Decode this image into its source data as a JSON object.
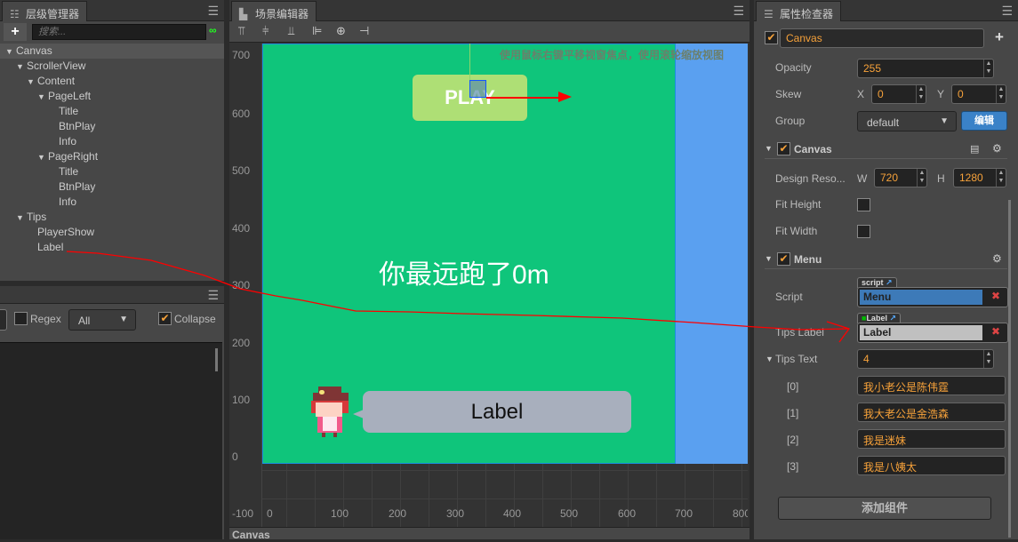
{
  "hierarchy": {
    "title": "层级管理器",
    "search_placeholder": "搜索...",
    "add": "+",
    "items": [
      {
        "label": "Canvas",
        "depth": 0,
        "expanded": true
      },
      {
        "label": "ScrollerView",
        "depth": 1,
        "expanded": true
      },
      {
        "label": "Content",
        "depth": 2,
        "expanded": true
      },
      {
        "label": "PageLeft",
        "depth": 3,
        "expanded": true
      },
      {
        "label": "Title",
        "depth": 4
      },
      {
        "label": "BtnPlay",
        "depth": 4
      },
      {
        "label": "Info",
        "depth": 4
      },
      {
        "label": "PageRight",
        "depth": 3,
        "expanded": true
      },
      {
        "label": "Title",
        "depth": 4
      },
      {
        "label": "BtnPlay",
        "depth": 4
      },
      {
        "label": "Info",
        "depth": 4
      },
      {
        "label": "Tips",
        "depth": 1,
        "expanded": true
      },
      {
        "label": "PlayerShow",
        "depth": 2
      },
      {
        "label": "Label",
        "depth": 2
      }
    ]
  },
  "console": {
    "regex": "Regex",
    "filter": "All",
    "collapse": "Collapse",
    "collapse_checked": true,
    "regex_checked": false
  },
  "scene": {
    "title": "场景编辑器",
    "hint": "使用鼠标右键平移视窗焦点，使用滚轮缩放视图",
    "play_label": "PLAY",
    "distance_text": "你最远跑了0m",
    "bubble_label": "Label",
    "status": "Canvas",
    "y_ticks": [
      "700",
      "600",
      "500",
      "400",
      "300",
      "200",
      "100",
      "0",
      "-100"
    ],
    "x_ticks": [
      "0",
      "100",
      "200",
      "300",
      "400",
      "500",
      "600",
      "700",
      "800"
    ],
    "colors": {
      "canvas": "#0fc57b",
      "outside": "#5aa0f0",
      "play_button": "#aedf75",
      "bubble": "#a8afbd"
    }
  },
  "inspector": {
    "title": "属性检查器",
    "node_name": "Canvas",
    "node_enabled": true,
    "opacity_label": "Opacity",
    "opacity": "255",
    "skew_label": "Skew",
    "skew_x_label": "X",
    "skew_x": "0",
    "skew_y_label": "Y",
    "skew_y": "0",
    "group_label": "Group",
    "group_value": "default",
    "group_edit": "编辑",
    "canvas_section": "Canvas",
    "design_res_label": "Design Reso...",
    "w_label": "W",
    "w": "720",
    "h_label": "H",
    "h": "1280",
    "fit_height": "Fit Height",
    "fit_width": "Fit Width",
    "menu_section": "Menu",
    "script_label": "Script",
    "script_tag": "script",
    "script_value": "Menu",
    "tips_label_label": "Tips Label",
    "tips_label_tag": "Label",
    "tips_label_value": "Label",
    "tips_text_label": "Tips Text",
    "tips_text_count": "4",
    "tips": [
      {
        "index": "[0]",
        "value": "我小老公是陈伟霆"
      },
      {
        "index": "[1]",
        "value": "我大老公是金浩森"
      },
      {
        "index": "[2]",
        "value": "我是迷妹"
      },
      {
        "index": "[3]",
        "value": "我是八姨太"
      }
    ],
    "add_component": "添加组件"
  }
}
